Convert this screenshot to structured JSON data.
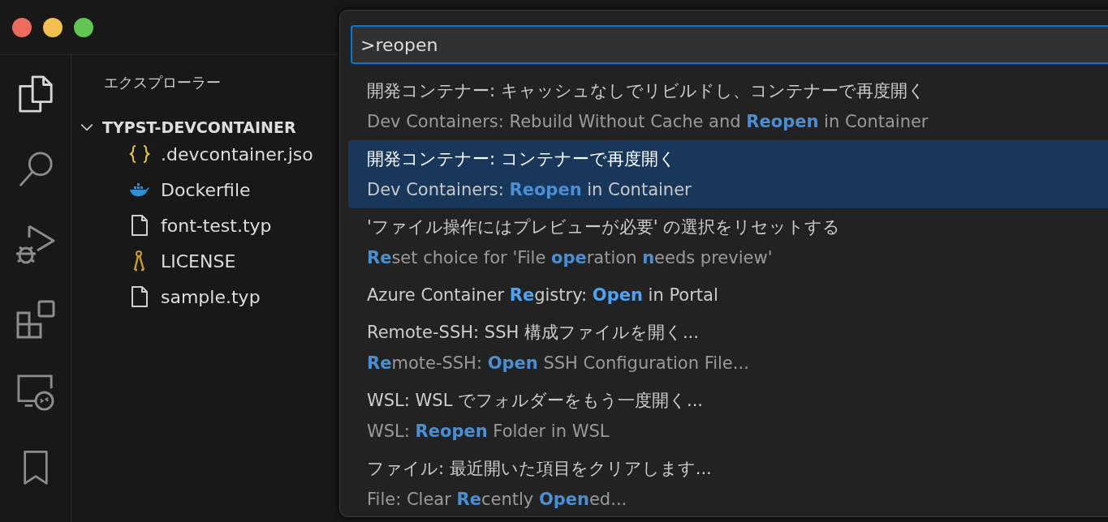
{
  "sidebar": {
    "title": "エクスプローラー",
    "folder": {
      "name": "TYPST-DEVCONTAINER",
      "expanded": true,
      "children": [
        {
          "name": ".devcontainer.jso",
          "kind": "json"
        },
        {
          "name": "Dockerfile",
          "kind": "docker"
        },
        {
          "name": "font-test.typ",
          "kind": "file"
        },
        {
          "name": "LICENSE",
          "kind": "license"
        },
        {
          "name": "sample.typ",
          "kind": "file"
        }
      ]
    }
  },
  "command_palette": {
    "input": ">reopen",
    "items": [
      {
        "label": "開発コンテナー: キャッシュなしでリビルドし、コンテナーで再度開く",
        "detail": "Dev Containers: Rebuild Without Cache and **Reopen** in Container",
        "selected": false
      },
      {
        "label": "開発コンテナー: コンテナーで再度開く",
        "detail": "Dev Containers: **Reopen** in Container",
        "selected": true
      },
      {
        "label": "'ファイル操作にはプレビューが必要' の選択をリセットする",
        "detail": "**Re**set choice for 'File **ope**ration **n**eeds preview'",
        "selected": false
      },
      {
        "label": "Azure Container **Re**gistry: **Open** in Portal",
        "selected": false
      },
      {
        "label": "Remote-SSH: SSH 構成ファイルを開く...",
        "detail": "**Re**mote-SSH: **Open** SSH Configuration File...",
        "selected": false
      },
      {
        "label": "WSL: WSL でフォルダーをもう一度開く...",
        "detail": "WSL: **Reopen** Folder in WSL",
        "selected": false
      },
      {
        "label": "ファイル: 最近開いた項目をクリアします...",
        "detail": "File: Clear **Re**cently **Open**ed...",
        "selected": false
      }
    ]
  }
}
